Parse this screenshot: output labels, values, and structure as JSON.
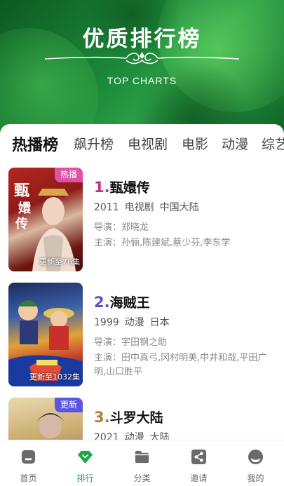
{
  "header": {
    "title": "优质排行榜",
    "subtitle": "TOP CHARTS"
  },
  "tabs": [
    {
      "label": "热播榜",
      "active": true
    },
    {
      "label": "飙升榜",
      "active": false
    },
    {
      "label": "电视剧",
      "active": false
    },
    {
      "label": "电影",
      "active": false
    },
    {
      "label": "动漫",
      "active": false
    },
    {
      "label": "综艺",
      "active": false
    }
  ],
  "items": [
    {
      "rank": "1.",
      "title": "甄嬛传",
      "year": "2011",
      "genre": "电视剧",
      "region": "中国大陆",
      "director": "导演：郑晓龙",
      "cast": "主演：孙俪,陈建斌,蔡少芬,李东学",
      "badge": "热播",
      "update": "更新至76集",
      "rank_color": "#c2338c",
      "badge_color": "#e052a9"
    },
    {
      "rank": "2.",
      "title": "海贼王",
      "year": "1999",
      "genre": "动漫",
      "region": "日本",
      "director": "导演：宇田钢之助",
      "cast": "主演：田中真弓,冈村明美,中井和哉,平田广明,山口胜平",
      "badge": "",
      "update": "更新至1032集",
      "rank_color": "#5b4fcf",
      "badge_color": ""
    },
    {
      "rank": "3.",
      "title": "斗罗大陆",
      "year": "2021",
      "genre": "动漫",
      "region": "大陆",
      "director": "",
      "cast": "",
      "badge": "更新",
      "update": "",
      "rank_color": "#b0813a",
      "badge_color": "#5a56e0"
    }
  ],
  "nav": [
    {
      "label": "首页",
      "icon": "home-icon",
      "active": false
    },
    {
      "label": "排行",
      "icon": "diamond-icon",
      "active": true
    },
    {
      "label": "分类",
      "icon": "folder-icon",
      "active": false
    },
    {
      "label": "邀请",
      "icon": "share-icon",
      "active": false
    },
    {
      "label": "我的",
      "icon": "profile-icon",
      "active": false
    }
  ],
  "colors": {
    "brand_green": "#1fa64a",
    "inactive_icon": "#6b6b6b"
  }
}
